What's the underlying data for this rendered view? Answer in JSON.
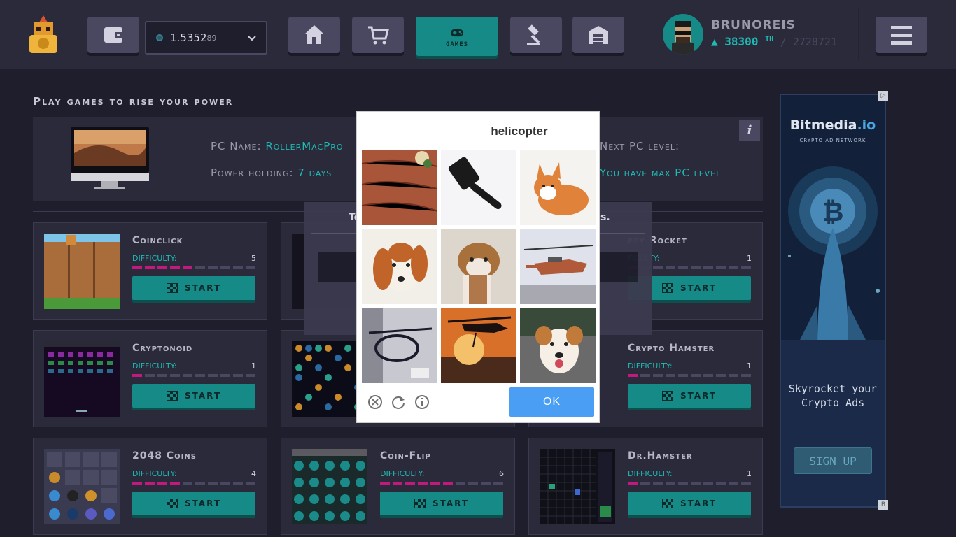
{
  "header": {
    "balance_main": "1.5352",
    "balance_small": "89",
    "games_label": "GAMES",
    "username": "BRUNOREIS",
    "power": "38300",
    "power_unit": "TH",
    "power_max": "/ 2728721"
  },
  "section_title": "Play games to rise your power",
  "pc": {
    "name_label": "PC Name:",
    "name_value": "RollerMacPro",
    "holding_label": "Power holding:",
    "holding_value": "7 days",
    "next_label": "Next PC level:",
    "next_value": "You have max PC level",
    "info": "i"
  },
  "overlay": {
    "text_left": "To",
    "text_right": "s."
  },
  "games": [
    {
      "title": "Coinclick",
      "difficulty_label": "DIFFICULTY:",
      "difficulty": 5,
      "start": "START"
    },
    {
      "title": "ppy Rocket",
      "difficulty_label": "FICULTY:",
      "difficulty": 1,
      "start": "START"
    },
    {
      "title": "Cryptonoid",
      "difficulty_label": "DIFFICULTY:",
      "difficulty": 1,
      "start": "START"
    },
    {
      "title": "Crypto Hamster",
      "difficulty_label": "DIFFICULTY:",
      "difficulty": 1,
      "start": "START"
    },
    {
      "title": "2048 Coins",
      "difficulty_label": "DIFFICULTY:",
      "difficulty": 4,
      "start": "START"
    },
    {
      "title": "Coin-Flip",
      "difficulty_label": "DIFFICULTY:",
      "difficulty": 6,
      "start": "START"
    },
    {
      "title": "Dr.Hamster",
      "difficulty_label": "DIFFICULTY:",
      "difficulty": 1,
      "start": "START"
    }
  ],
  "captcha": {
    "prompt": "helicopter",
    "tiles": [
      "cracked-wood",
      "spatula",
      "corgi",
      "puppy",
      "bulldog",
      "helicopter",
      "helicopter",
      "helicopter",
      "dog"
    ],
    "ok": "OK"
  },
  "ad": {
    "brand_a": "Bitmedia",
    "brand_b": ".io",
    "tagline": "CRYPTO AD NETWORK",
    "copy": "Skyrocket your Crypto Ads",
    "signup": "SIGN UP",
    "corner_top": "▷",
    "corner_bottom": "B"
  },
  "colors": {
    "accent": "#168a86",
    "accent_text": "#1fbab3",
    "difficulty_on": "#c2197f",
    "background": "#1f1e2c",
    "panel": "#2b2a3b",
    "ok_button": "#4a9ff5"
  }
}
